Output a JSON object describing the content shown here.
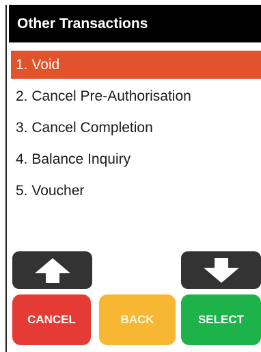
{
  "header": {
    "title": "Other Transactions"
  },
  "menu": {
    "items": [
      {
        "label": "1. Void"
      },
      {
        "label": "2. Cancel Pre-Authorisation"
      },
      {
        "label": "3. Cancel Completion"
      },
      {
        "label": "4. Balance Inquiry"
      },
      {
        "label": "5. Voucher"
      }
    ],
    "selected_index": 0
  },
  "nav": {
    "up_icon": "arrow-up-icon",
    "down_icon": "arrow-down-icon"
  },
  "actions": {
    "cancel_label": "CANCEL",
    "back_label": "BACK",
    "select_label": "SELECT"
  },
  "colors": {
    "title_bar": "#000000",
    "selected_row": "#e2522b",
    "cancel": "#e63b35",
    "back": "#f7b733",
    "select": "#1db34a",
    "arrow_button": "#333333"
  }
}
